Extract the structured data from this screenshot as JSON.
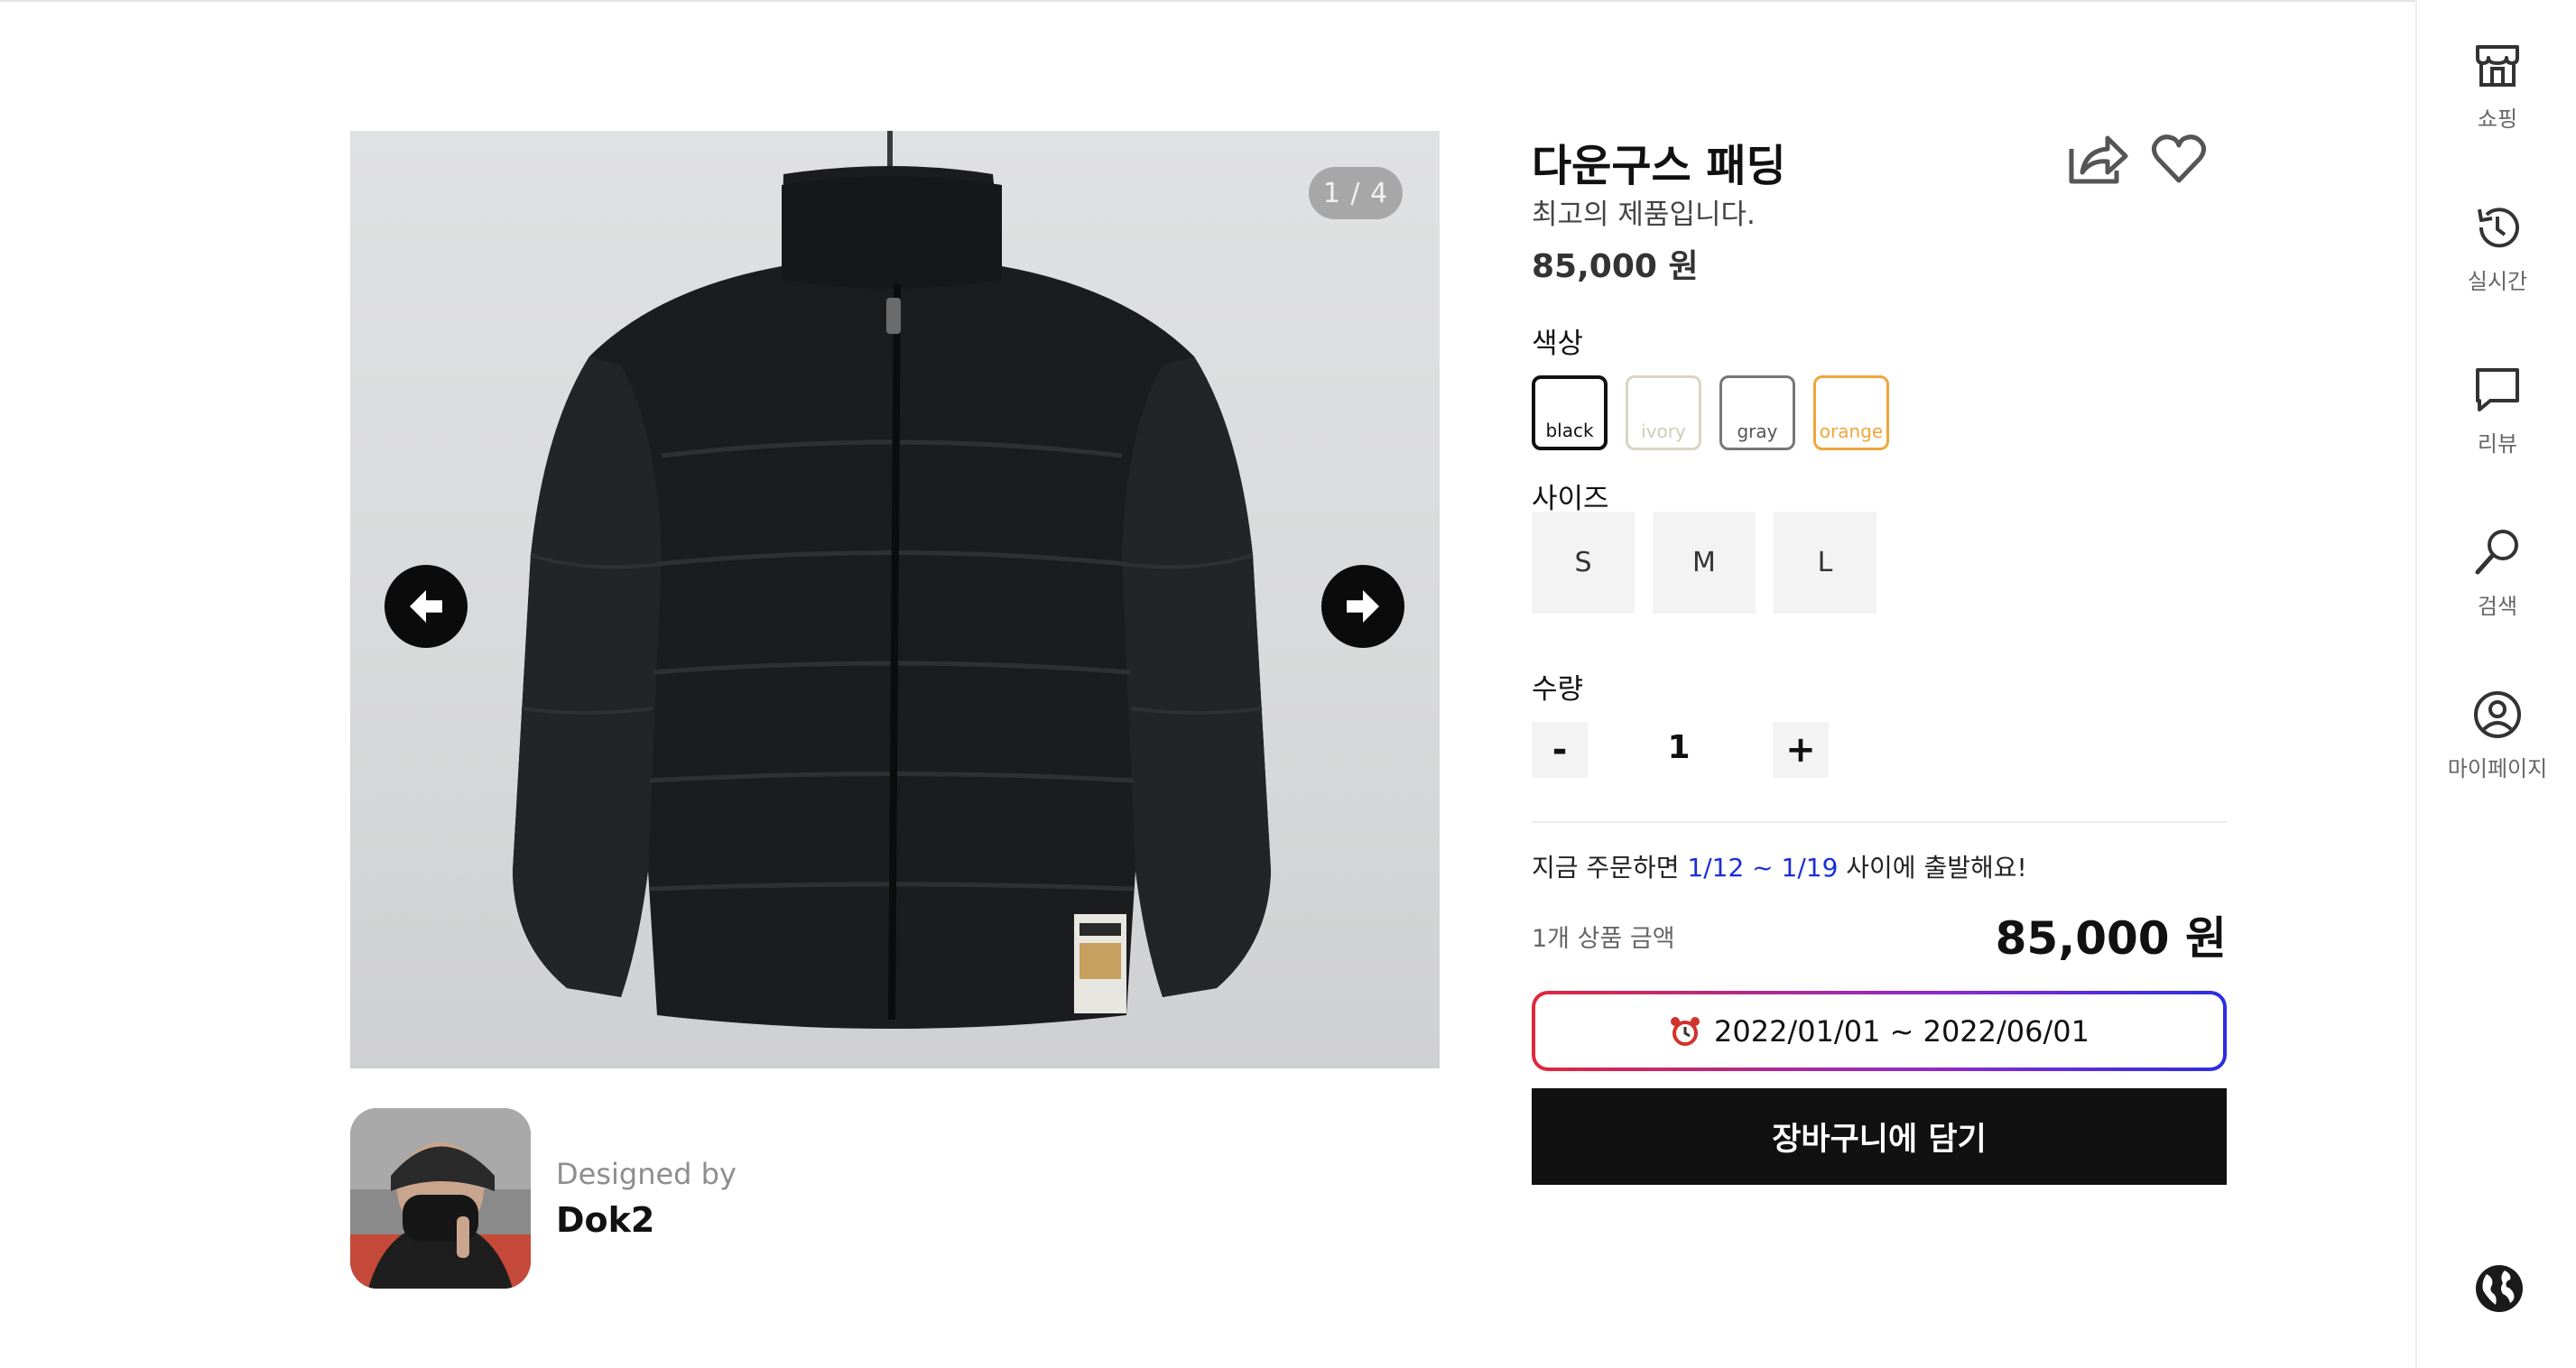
{
  "gallery": {
    "counter": "1 / 4",
    "current_index": 1,
    "total_images": 4,
    "prev_icon": "arrow-left-icon",
    "next_icon": "arrow-right-icon"
  },
  "designer": {
    "designed_by_label": "Designed by",
    "name": "Dok2"
  },
  "product": {
    "title": "다운구스 패딩",
    "subtitle": "최고의 제품입니다.",
    "price": "85,000 원",
    "share_icon": "share-icon",
    "like_icon": "heart-icon"
  },
  "color": {
    "label": "색상",
    "options": [
      {
        "label": "black",
        "color": "#111111",
        "selected": true
      },
      {
        "label": "ivory",
        "color": "#d8d5c2",
        "selected": false
      },
      {
        "label": "gray",
        "color": "#777777",
        "selected": false
      },
      {
        "label": "orange",
        "color": "#f0a63a",
        "selected": false
      }
    ]
  },
  "size": {
    "label": "사이즈",
    "options": [
      "S",
      "M",
      "L"
    ]
  },
  "quantity": {
    "label": "수량",
    "minus": "-",
    "value": "1",
    "plus": "+"
  },
  "shipping": {
    "prefix": "지금 주문하면 ",
    "dates": "1/12 ~ 1/19",
    "suffix": " 사이에 출발해요!",
    "date_color": "#1a2ed8"
  },
  "summary": {
    "label": "1개 상품 금액",
    "total": "85,000 원"
  },
  "period": {
    "icon": "alarm-clock-icon",
    "text": "2022/01/01 ~ 2022/06/01"
  },
  "cart": {
    "button_label": "장바구니에 담기"
  },
  "sidebar": {
    "items": [
      {
        "label": "쇼핑",
        "icon": "store-icon"
      },
      {
        "label": "실시간",
        "icon": "history-icon"
      },
      {
        "label": "리뷰",
        "icon": "chat-bubble-icon"
      },
      {
        "label": "검색",
        "icon": "search-icon"
      },
      {
        "label": "마이페이지",
        "icon": "user-circle-icon"
      }
    ],
    "language_icon": "globe-icon"
  }
}
